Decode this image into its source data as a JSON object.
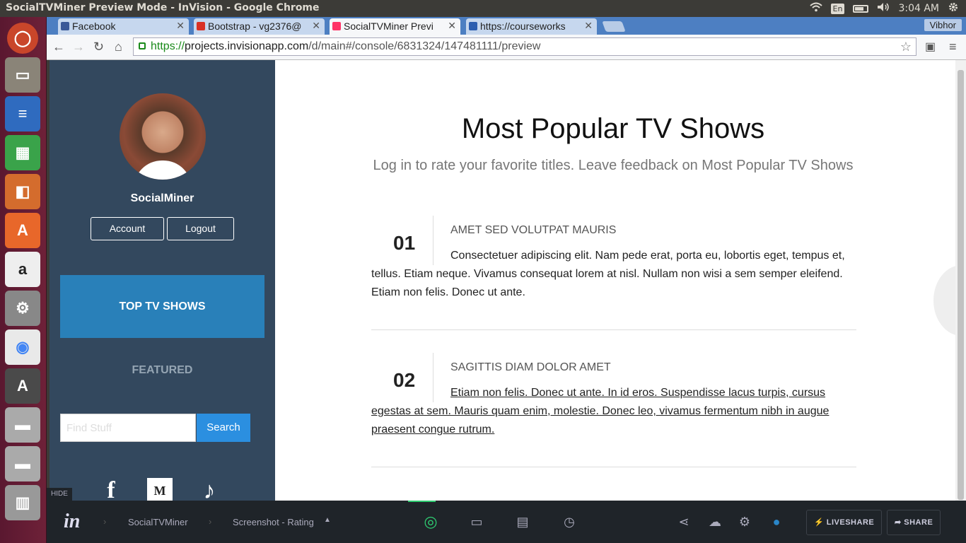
{
  "system": {
    "window_title": "SocialTVMiner Preview Mode - InVision - Google Chrome",
    "keyboard": "En",
    "time": "3:04 AM"
  },
  "browser": {
    "tabs": [
      {
        "label": "Facebook",
        "color": "#3b5998"
      },
      {
        "label": "Bootstrap - vg2376@",
        "color": "#d93025"
      },
      {
        "label": "SocialTVMiner Previ",
        "color": "#ff3366"
      },
      {
        "label": "https://courseworks",
        "color": "#2a5db0"
      }
    ],
    "user": "Vibhor",
    "url_scheme": "https://",
    "url_host": "projects.invisionapp.com",
    "url_path": "/d/main#/console/6831324/147481111/preview"
  },
  "sidebar": {
    "username": "SocialMiner",
    "account_label": "Account",
    "logout_label": "Logout",
    "top_label": "TOP TV SHOWS",
    "featured_label": "FEATURED",
    "search_placeholder": "Find Stuff",
    "search_label": "Search",
    "social_icons": [
      "facebook-icon",
      "medium-icon",
      "rdio-icon"
    ]
  },
  "main": {
    "title": "Most Popular TV Shows",
    "subtitle": "Log in to rate your favorite titles. Leave feedback on Most Popular TV Shows",
    "items": [
      {
        "num": "01",
        "title": "AMET SED VOLUTPAT MAURIS",
        "text": "Consectetuer adipiscing elit. Nam pede erat, porta eu, lobortis eget, tempus et, tellus. Etiam neque. Vivamus consequat lorem at nisl. Nullam non wisi a sem semper eleifend. Etiam non felis. Donec ut ante."
      },
      {
        "num": "02",
        "title": "SAGITTIS DIAM DOLOR AMET",
        "text": "Etiam non felis. Donec ut ante. In id eros. Suspendisse lacus turpis, cursus egestas at sem. Mauris quam enim, molestie. Donec leo, vivamus fermentum nibh in augue praesent congue rutrum."
      }
    ]
  },
  "invision": {
    "hide_label": "HIDE",
    "logo": "in",
    "project": "SocialTVMiner",
    "screen": "Screenshot - Rating",
    "liveshare_label": "LIVESHARE",
    "share_label": "SHARE"
  },
  "colors": {
    "sidebar": "#33485e",
    "accent": "#2980b9",
    "search": "#2b8fe0"
  }
}
